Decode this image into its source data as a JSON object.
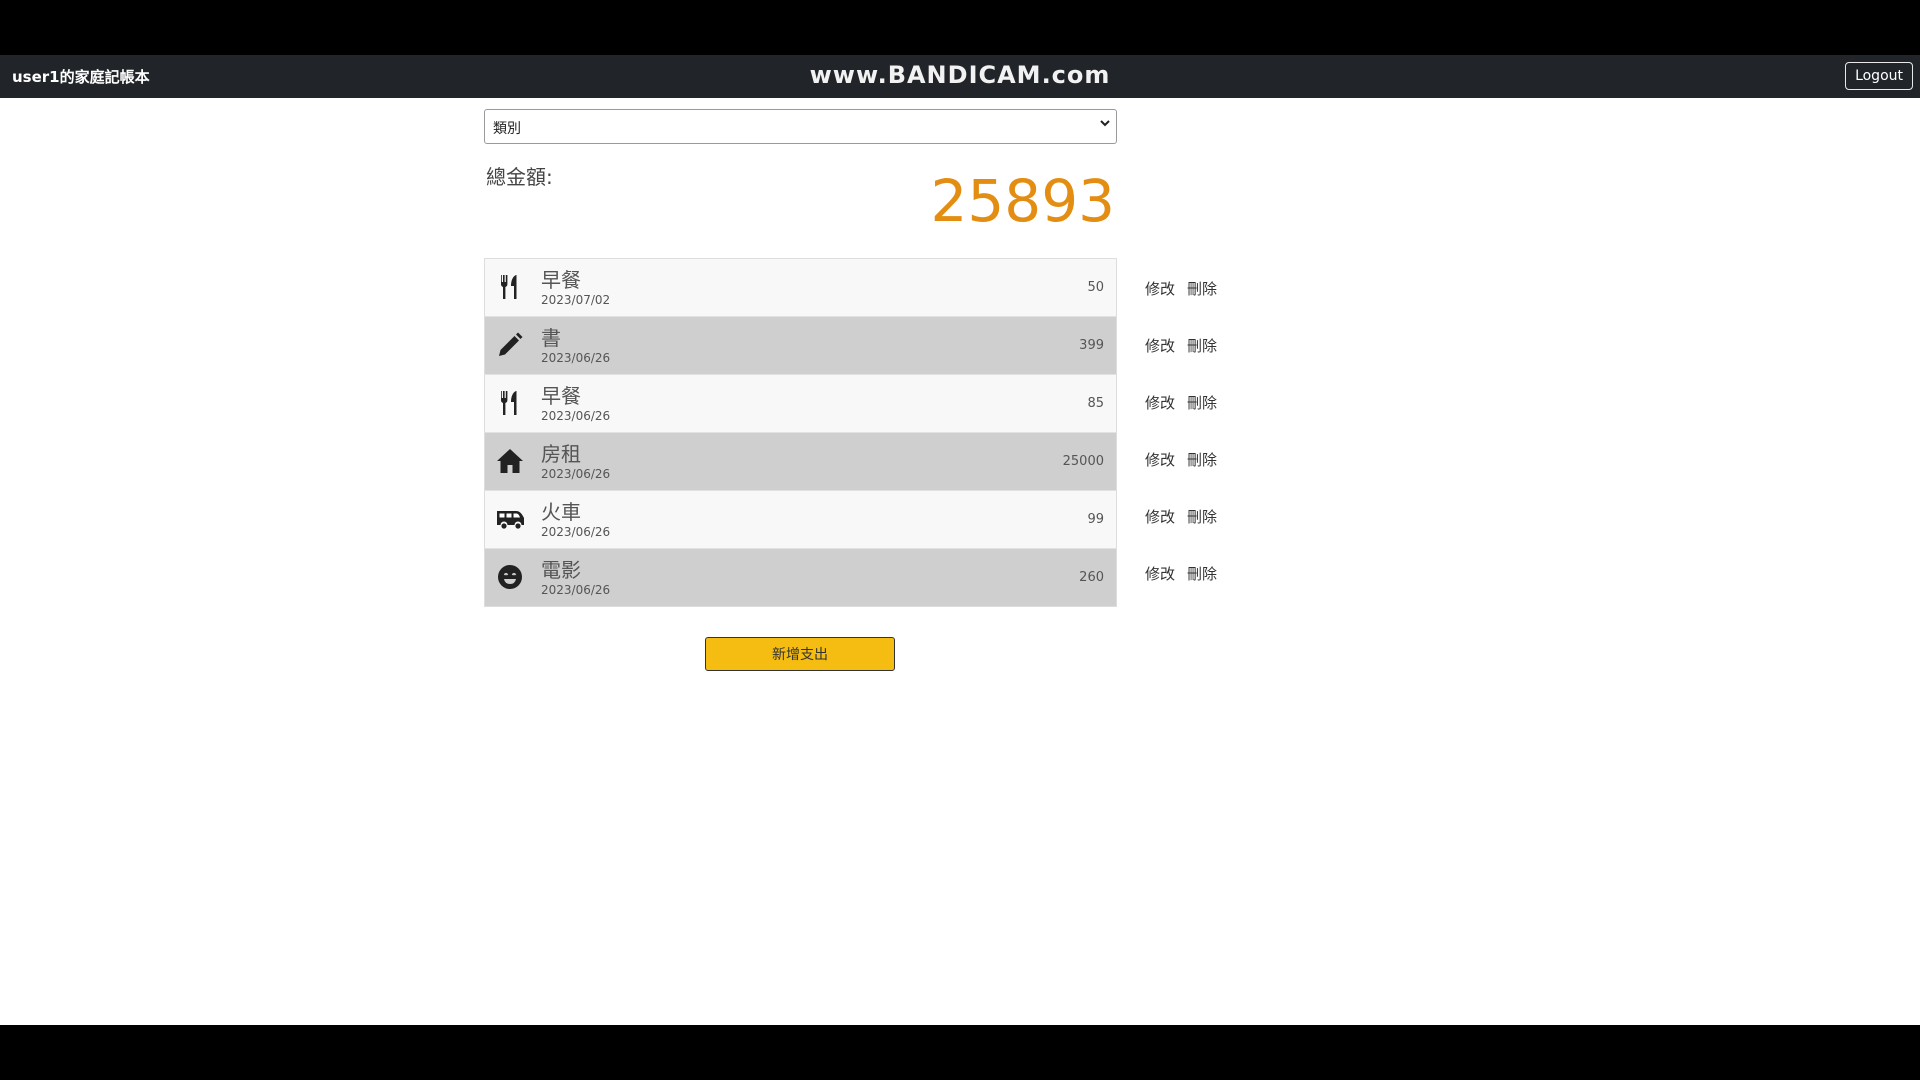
{
  "header": {
    "brand": "user1的家庭記帳本",
    "watermark": "www.BANDICAM.com",
    "logout_label": "Logout"
  },
  "filter": {
    "category_selected": "類別"
  },
  "total": {
    "label": "總金額:",
    "value": "25893"
  },
  "expenses": [
    {
      "name": "早餐",
      "date": "2023/07/02",
      "amount": "50",
      "icon": "utensils-icon"
    },
    {
      "name": "書",
      "date": "2023/06/26",
      "amount": "399",
      "icon": "pencil-icon"
    },
    {
      "name": "早餐",
      "date": "2023/06/26",
      "amount": "85",
      "icon": "utensils-icon"
    },
    {
      "name": "房租",
      "date": "2023/06/26",
      "amount": "25000",
      "icon": "house-icon"
    },
    {
      "name": "火車",
      "date": "2023/06/26",
      "amount": "99",
      "icon": "van-icon"
    },
    {
      "name": "電影",
      "date": "2023/06/26",
      "amount": "260",
      "icon": "smile-icon"
    }
  ],
  "row_actions": {
    "edit_label": "修改",
    "delete_label": "刪除"
  },
  "add_button_label": "新增支出",
  "colors": {
    "accent": "#e38e12",
    "button": "#f5bd12",
    "navbar": "#212529"
  }
}
